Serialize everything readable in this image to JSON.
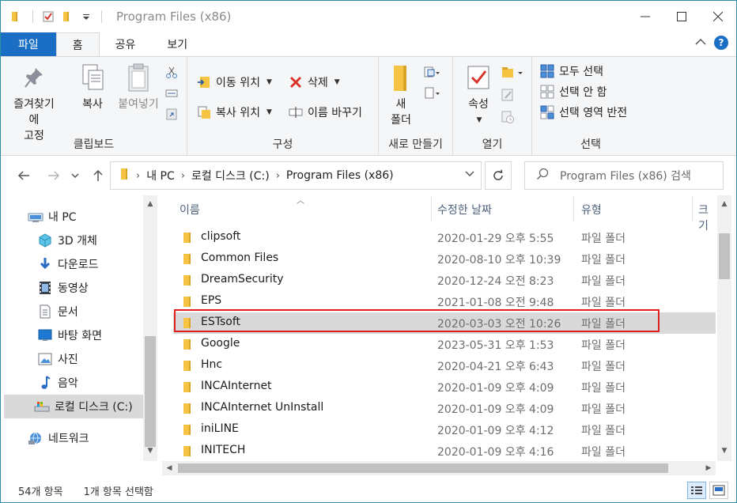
{
  "window": {
    "title": "Program Files (x86)",
    "controls": {
      "minimize": "—",
      "maximize": "☐",
      "close": "✕"
    }
  },
  "ribbon_tabs": [
    {
      "label": "파일"
    },
    {
      "label": "홈"
    },
    {
      "label": "공유"
    },
    {
      "label": "보기"
    }
  ],
  "ribbon": {
    "clipboard": {
      "pin_label_1": "즐겨찾기에",
      "pin_label_2": "고정",
      "copy_label": "복사",
      "paste_label": "붙여넣기",
      "group_label": "클립보드"
    },
    "organize": {
      "move_to": "이동 위치",
      "copy_to": "복사 위치",
      "delete": "삭제",
      "rename": "이름 바꾸기",
      "group_label": "구성"
    },
    "new": {
      "new_folder_1": "새",
      "new_folder_2": "폴더",
      "group_label": "새로 만들기"
    },
    "open": {
      "properties": "속성",
      "group_label": "열기"
    },
    "select": {
      "select_all": "모두 선택",
      "select_none": "선택 안 함",
      "invert": "선택 영역 반전",
      "group_label": "선택"
    }
  },
  "address": {
    "crumbs": [
      "내 PC",
      "로컬 디스크 (C:)",
      "Program Files (x86)"
    ],
    "search_placeholder": "Program Files (x86) 검색"
  },
  "nav_pane": {
    "items": [
      {
        "label": "내 PC",
        "icon": "pc-icon"
      },
      {
        "label": "3D 개체",
        "icon": "3d-objects-icon"
      },
      {
        "label": "다운로드",
        "icon": "download-icon"
      },
      {
        "label": "동영상",
        "icon": "video-icon"
      },
      {
        "label": "문서",
        "icon": "document-icon"
      },
      {
        "label": "바탕 화면",
        "icon": "desktop-icon"
      },
      {
        "label": "사진",
        "icon": "pictures-icon"
      },
      {
        "label": "음악",
        "icon": "music-icon"
      },
      {
        "label": "로컬 디스크 (C:)",
        "icon": "local-disk-icon"
      },
      {
        "label": "네트워크",
        "icon": "network-icon"
      }
    ]
  },
  "columns": {
    "name": "이름",
    "date": "수정한 날짜",
    "type": "유형",
    "size": "크기"
  },
  "files": [
    {
      "name": "clipsoft",
      "date": "2020-01-29 오후 5:55",
      "type": "파일 폴더"
    },
    {
      "name": "Common Files",
      "date": "2020-08-10 오후 10:39",
      "type": "파일 폴더"
    },
    {
      "name": "DreamSecurity",
      "date": "2020-12-24 오전 8:23",
      "type": "파일 폴더"
    },
    {
      "name": "EPS",
      "date": "2021-01-08 오전 9:48",
      "type": "파일 폴더"
    },
    {
      "name": "ESTsoft",
      "date": "2020-03-03 오전 10:26",
      "type": "파일 폴더"
    },
    {
      "name": "Google",
      "date": "2023-05-31 오후 1:53",
      "type": "파일 폴더"
    },
    {
      "name": "Hnc",
      "date": "2020-04-21 오후 6:43",
      "type": "파일 폴더"
    },
    {
      "name": "INCAInternet",
      "date": "2020-01-09 오후 4:09",
      "type": "파일 폴더"
    },
    {
      "name": "INCAInternet UnInstall",
      "date": "2020-01-09 오후 4:09",
      "type": "파일 폴더"
    },
    {
      "name": "iniLINE",
      "date": "2020-01-09 오후 4:12",
      "type": "파일 폴더"
    },
    {
      "name": "INITECH",
      "date": "2020-01-09 오후 4:16",
      "type": "파일 폴더"
    }
  ],
  "status": {
    "item_count": "54개 항목",
    "selected": "1개 항목 선택함"
  },
  "colors": {
    "accent": "#1a6fc4",
    "folder": "#f6c342",
    "selection": "#d9d9d9",
    "highlight_box": "#e0201f"
  }
}
